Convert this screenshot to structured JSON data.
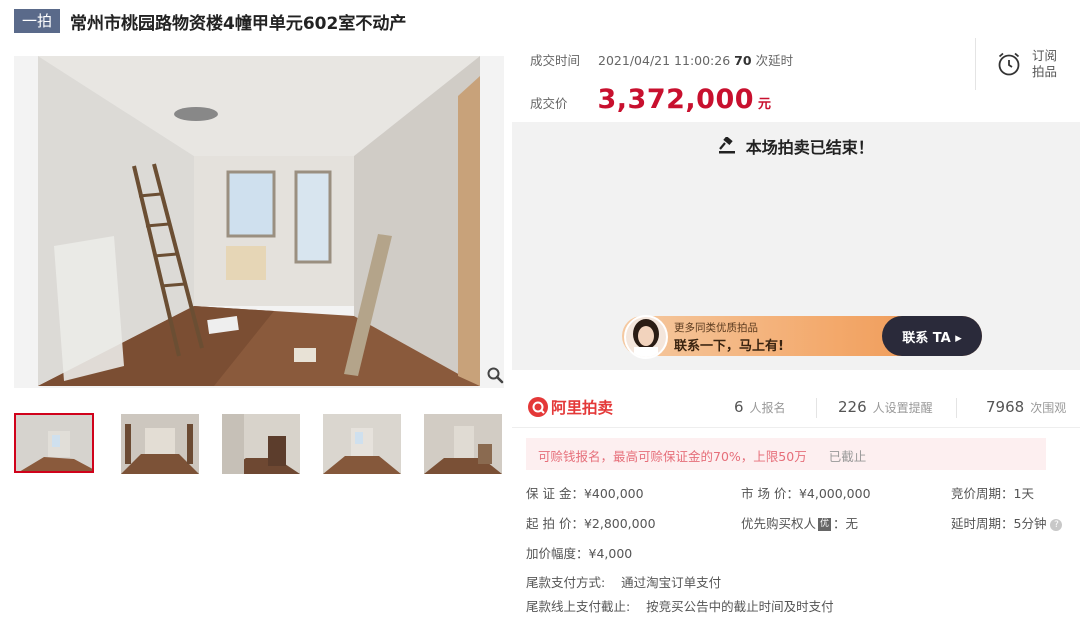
{
  "header": {
    "tag": "一拍",
    "title": "常州市桃园路物资楼4幢甲单元602室不动产"
  },
  "deal": {
    "time_label": "成交时间",
    "time_value": "2021/04/21 11:00:26",
    "delay_count": "70",
    "delay_suffix": "次延时",
    "price_label": "成交价",
    "price": "3,372,000",
    "price_unit": "元"
  },
  "subscribe": {
    "line1": "订阅",
    "line2": "拍品"
  },
  "status": {
    "ended": "本场拍卖已结束！"
  },
  "promo": {
    "line1": "更多同类优质拍品",
    "line2": "联系一下，马上有!",
    "button": "联系 TA ▸"
  },
  "platform": {
    "name": "阿里拍卖"
  },
  "stats": [
    {
      "num": "6",
      "label": "人报名"
    },
    {
      "num": "226",
      "label": "人设置提醒"
    },
    {
      "num": "7968",
      "label": "次围观"
    }
  ],
  "notice": {
    "text": "可赊钱报名，最高可赊保证金的70%，上限50万",
    "status": "已截止"
  },
  "details": {
    "deposit": "保 证 金：¥400,000",
    "market_price": "市 场 价：¥4,000,000",
    "bid_cycle": "竞价周期：1天",
    "start_price": "起 拍 价：¥2,800,000",
    "priority_label": "优先购买权人",
    "priority_icon": "优",
    "priority_value": "：无",
    "delay_cycle": "延时周期：5分钟",
    "increment": "加价幅度：¥4,000",
    "payment_method": "尾款支付方式:    通过淘宝订单支付",
    "payment_deadline": "尾款线上支付截止:    按竞买公告中的截止时间及时支付"
  },
  "icons": {
    "zoom": "search-icon",
    "alarm": "alarm-clock-icon",
    "gavel": "gavel-icon",
    "help": "question-icon"
  },
  "colors": {
    "price_red": "#c8102e",
    "brand_red": "#e43838",
    "tag_bg": "#5a6a8a",
    "active_thumb_border": "#d0021b"
  }
}
